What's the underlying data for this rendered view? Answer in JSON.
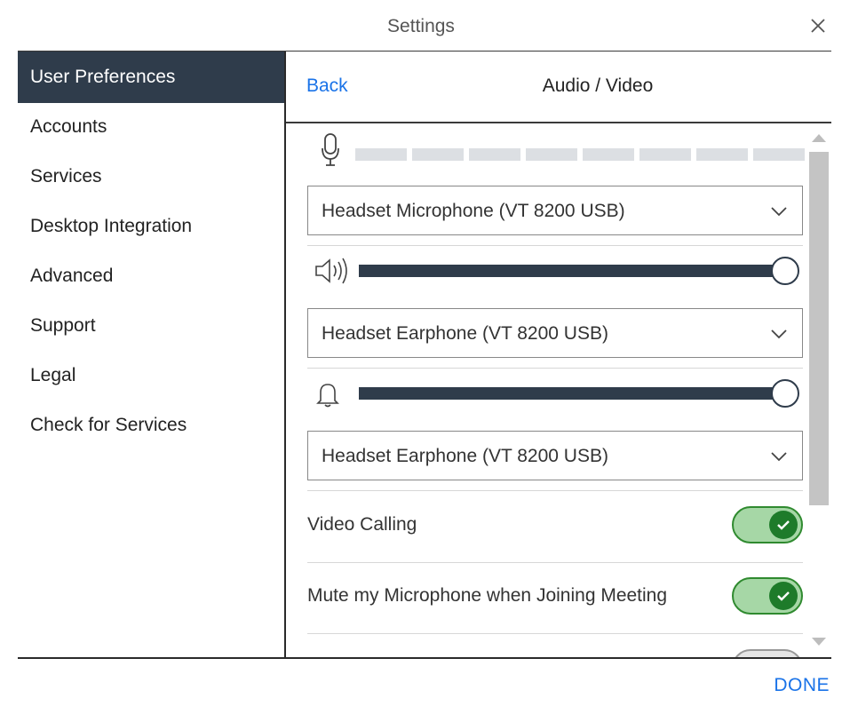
{
  "window": {
    "title": "Settings"
  },
  "sidebar": {
    "items": [
      {
        "label": "User Preferences",
        "active": true
      },
      {
        "label": "Accounts"
      },
      {
        "label": "Services"
      },
      {
        "label": "Desktop Integration"
      },
      {
        "label": "Advanced"
      },
      {
        "label": "Support"
      },
      {
        "label": "Legal"
      },
      {
        "label": "Check for Services"
      }
    ]
  },
  "header": {
    "back_label": "Back",
    "title": "Audio / Video"
  },
  "audio": {
    "mic_meter": {
      "icon": "microphone-icon",
      "segments": 8,
      "level": 0
    },
    "microphone_device": "Headset Microphone (VT 8200 USB)",
    "speaker": {
      "icon": "speaker-icon",
      "volume_percent": 100
    },
    "speaker_device": "Headset Earphone (VT 8200 USB)",
    "ringer": {
      "icon": "bell-icon",
      "volume_percent": 100
    },
    "ringer_device": "Headset Earphone (VT 8200 USB)"
  },
  "toggles": [
    {
      "label": "Video Calling",
      "on": true
    },
    {
      "label": "Mute my Microphone when Joining Meeting",
      "on": true
    }
  ],
  "footer": {
    "done_label": "DONE"
  },
  "colors": {
    "accent": "#1a73e8",
    "nav_active": "#2f3c4b",
    "toggle_on_track": "#a6d7a6",
    "toggle_on_knob": "#1e7b2a"
  }
}
